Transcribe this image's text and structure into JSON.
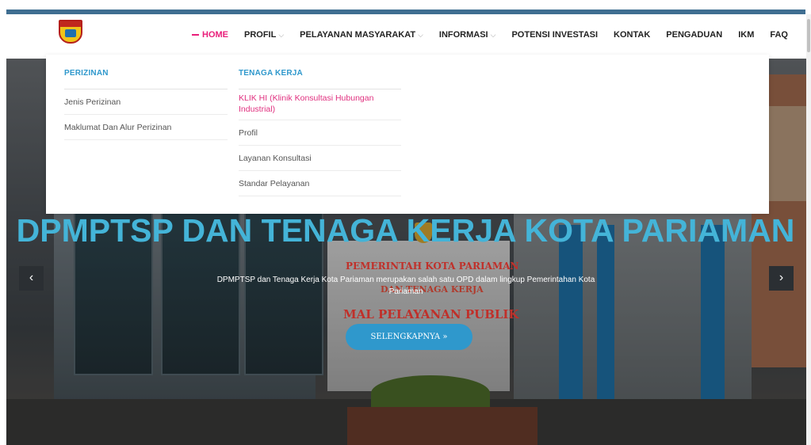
{
  "nav": {
    "items": [
      {
        "label": "HOME",
        "active": true
      },
      {
        "label": "PROFIL",
        "has_dropdown": true
      },
      {
        "label": "PELAYANAN MASYARAKAT",
        "has_dropdown": true
      },
      {
        "label": "INFORMASI",
        "has_dropdown": true
      },
      {
        "label": "POTENSI INVESTASI"
      },
      {
        "label": "KONTAK"
      },
      {
        "label": "PENGADUAN"
      },
      {
        "label": "IKM"
      },
      {
        "label": "FAQ"
      }
    ],
    "chevron": "⌵"
  },
  "megamenu": {
    "columns": [
      {
        "heading": "PERIZINAN",
        "items": [
          "Jenis Perizinan",
          "Maklumat Dan Alur Perizinan"
        ]
      },
      {
        "heading": "TENAGA KERJA",
        "items": [
          "KLIK HI (Klinik Konsultasi Hubungan Industrial)",
          "Profil",
          "Layanan Konsultasi",
          "Standar Pelayanan"
        ]
      }
    ]
  },
  "hero": {
    "title": "DPMPTSP DAN TENAGA KERJA KOTA PARIAMAN",
    "caption": "DPMPTSP dan Tenaga Kerja Kota Pariaman merupakan salah satu OPD dalam lingkup Pemerintahan Kota Pariaman",
    "cta_label": "SELENGKAPNYA »",
    "signage": {
      "line1": "PEMERINTAH KOTA PARIAMAN",
      "line2": "DAN TENAGA KERJA",
      "line3": "MAL PELAYANAN PUBLIK"
    },
    "prev_icon": "‹",
    "next_icon": "›"
  },
  "colors": {
    "accent": "#e91e7a",
    "title_blue": "#44b4d8",
    "button_blue": "#2f98cc",
    "topbar": "#3f6e91"
  }
}
